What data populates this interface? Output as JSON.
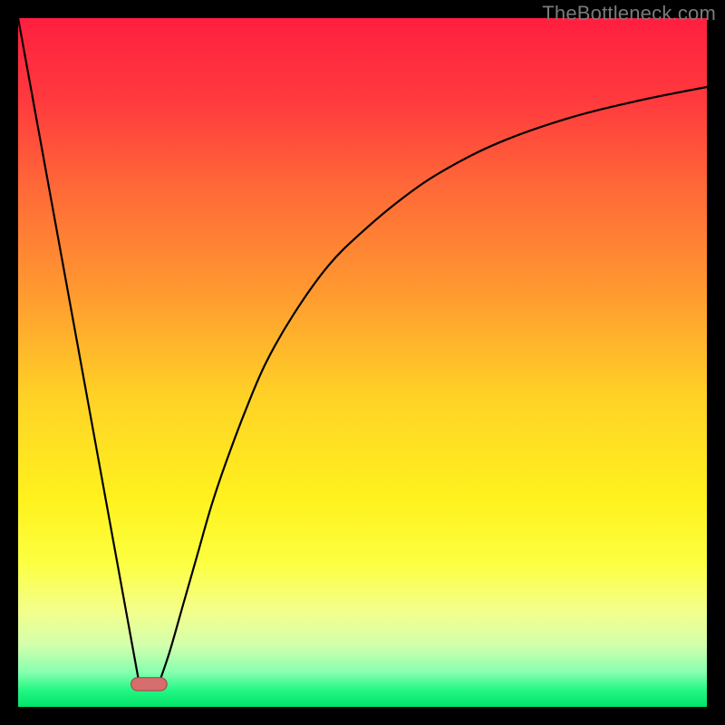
{
  "watermark": "TheBottleneck.com",
  "chart_data": {
    "type": "line",
    "title": "",
    "xlabel": "",
    "ylabel": "",
    "xlim": [
      0,
      100
    ],
    "ylim": [
      0,
      100
    ],
    "grid": false,
    "legend": false,
    "background_gradient": {
      "stops": [
        {
          "offset": 0.0,
          "color": "#ff1f3f"
        },
        {
          "offset": 0.12,
          "color": "#ff3a3e"
        },
        {
          "offset": 0.25,
          "color": "#ff6a37"
        },
        {
          "offset": 0.4,
          "color": "#ff9a30"
        },
        {
          "offset": 0.55,
          "color": "#ffd226"
        },
        {
          "offset": 0.7,
          "color": "#fff21e"
        },
        {
          "offset": 0.79,
          "color": "#fcff40"
        },
        {
          "offset": 0.86,
          "color": "#f4ff8a"
        },
        {
          "offset": 0.91,
          "color": "#d3ffac"
        },
        {
          "offset": 0.95,
          "color": "#86ffb0"
        },
        {
          "offset": 0.975,
          "color": "#25f884"
        },
        {
          "offset": 1.0,
          "color": "#00e56a"
        }
      ]
    },
    "series": [
      {
        "name": "left-branch",
        "x": [
          0,
          17.6
        ],
        "y": [
          100,
          3.3
        ]
      },
      {
        "name": "right-branch",
        "x": [
          20.4,
          22,
          24,
          26,
          28,
          30,
          33,
          36,
          40,
          45,
          50,
          56,
          62,
          70,
          80,
          90,
          100
        ],
        "y": [
          3.3,
          8,
          15,
          22,
          29,
          35,
          43,
          50,
          57,
          64,
          69,
          74,
          78,
          82,
          85.5,
          88,
          90
        ]
      }
    ],
    "marker": {
      "x_center": 19.0,
      "y": 3.3,
      "rx": 2.6,
      "ry": 0.95,
      "fill": "#d66e6e",
      "stroke": "#a94b4b"
    },
    "line_style": {
      "stroke": "#000000",
      "width": 2.2
    }
  }
}
